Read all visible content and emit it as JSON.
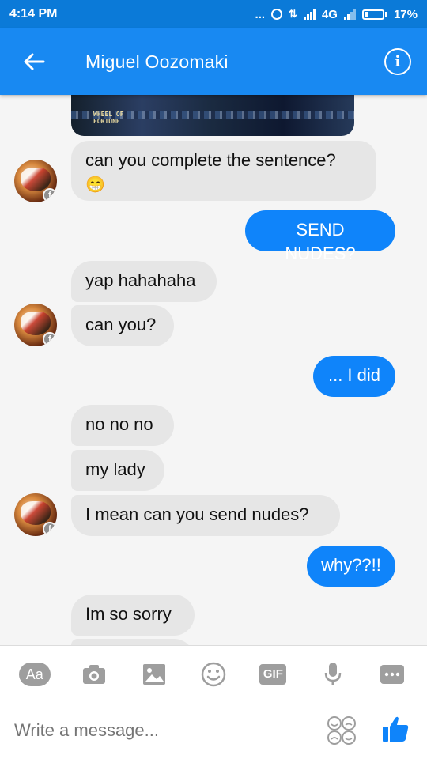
{
  "status": {
    "time": "4:14 PM",
    "dots": "...",
    "network": "4G",
    "battery": "17%"
  },
  "header": {
    "contact_name": "Miguel Oozomaki",
    "back_icon": "arrow-left-icon",
    "info_icon": "info-icon"
  },
  "image_message": {
    "caption": "WHEEL OF\nFORTUNE"
  },
  "messages": [
    {
      "side": "in",
      "text": "can you complete the sentence?",
      "emoji": "😁"
    },
    {
      "side": "out",
      "text": "SEND NUDES?"
    },
    {
      "side": "in",
      "text": "yap hahahaha"
    },
    {
      "side": "in",
      "text": "can you?"
    },
    {
      "side": "out",
      "text": "... I did"
    },
    {
      "side": "in",
      "text": "no no no"
    },
    {
      "side": "in",
      "text": "my lady"
    },
    {
      "side": "in",
      "text": "I mean can you send nudes?"
    },
    {
      "side": "out",
      "text": "why??!!"
    },
    {
      "side": "in",
      "text": "Im so sorry"
    }
  ],
  "toolbar": {
    "items": [
      {
        "icon": "text-aa-icon",
        "label": "Aa"
      },
      {
        "icon": "camera-icon"
      },
      {
        "icon": "image-icon"
      },
      {
        "icon": "smiley-icon"
      },
      {
        "icon": "gif-icon",
        "label": "GIF"
      },
      {
        "icon": "microphone-icon"
      },
      {
        "icon": "more-icon"
      }
    ]
  },
  "composer": {
    "placeholder": "Write a message...",
    "emoji_icon": "emoji-faces-icon",
    "like_icon": "thumbs-up-icon"
  },
  "colors": {
    "status_bar": "#0b7ad8",
    "app_bar": "#1889f2",
    "outgoing_bubble": "#0f84fa",
    "incoming_bubble": "#e6e6e6",
    "icon_gray": "#9e9e9e"
  }
}
